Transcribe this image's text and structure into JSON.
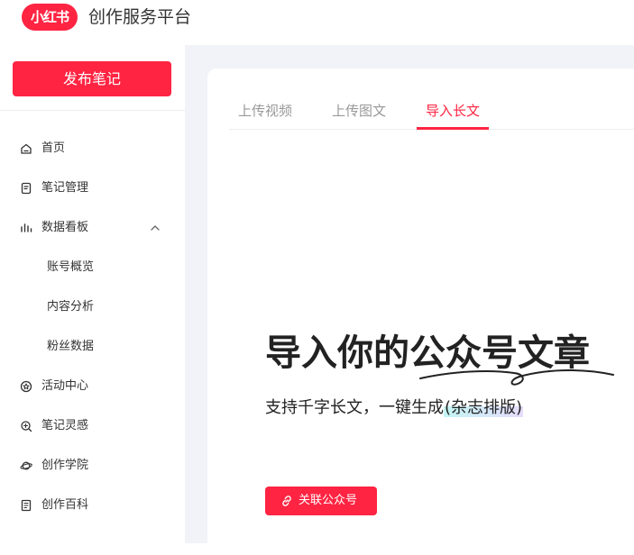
{
  "header": {
    "logo_text": "小红书",
    "app_title": "创作服务平台"
  },
  "sidebar": {
    "publish_label": "发布笔记",
    "items": [
      {
        "label": "首页",
        "icon": "home-icon"
      },
      {
        "label": "笔记管理",
        "icon": "note-icon"
      },
      {
        "label": "数据看板",
        "icon": "bar-chart-icon",
        "expanded": true,
        "children": [
          {
            "label": "账号概览"
          },
          {
            "label": "内容分析"
          },
          {
            "label": "粉丝数据"
          }
        ]
      },
      {
        "label": "活动中心",
        "icon": "badge-icon"
      },
      {
        "label": "笔记灵感",
        "icon": "inspiration-icon"
      },
      {
        "label": "创作学院",
        "icon": "planet-icon"
      },
      {
        "label": "创作百科",
        "icon": "book-icon"
      }
    ]
  },
  "main": {
    "tabs": [
      {
        "label": "上传视频",
        "active": false
      },
      {
        "label": "上传图文",
        "active": false
      },
      {
        "label": "导入长文",
        "active": true
      }
    ],
    "hero": {
      "title": "导入你的公众号文章",
      "subtitle_prefix": "支持千字长文，一键生成",
      "subtitle_highlight": "(杂志排版)"
    },
    "link_button_label": "关联公众号",
    "link_button_icon": "link-icon"
  },
  "colors": {
    "brand": "#ff2442",
    "background": "#f1f3f8",
    "text": "#333333",
    "muted": "#999999"
  }
}
